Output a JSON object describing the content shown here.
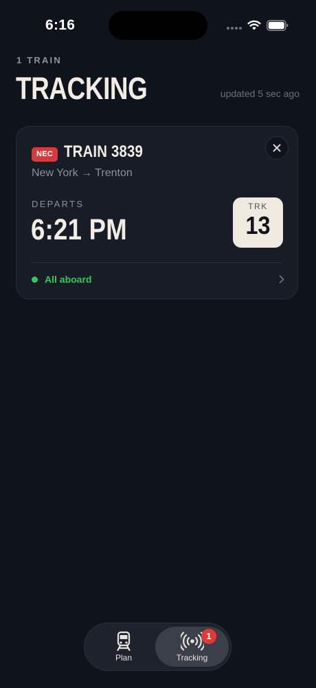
{
  "status_bar": {
    "time": "6:16",
    "icons": [
      "signal-icon",
      "wifi-icon",
      "battery-icon"
    ]
  },
  "header": {
    "count_label": "1 TRAIN",
    "title": "TRACKING",
    "updated": "updated 5 sec ago"
  },
  "train_card": {
    "line_badge": "NEC",
    "train_number": "TRAIN 3839",
    "route": "New York → Trenton",
    "departs_label": "DEPARTS",
    "depart_time": "6:21 PM",
    "track_label": "TRK",
    "track_number": "13",
    "status": "All aboard",
    "close_icon": "close-icon",
    "chevron_icon": "chevron-right-icon"
  },
  "tab_bar": {
    "tabs": [
      {
        "label": "Plan",
        "icon": "train-icon",
        "selected": false
      },
      {
        "label": "Tracking",
        "icon": "broadcast-icon",
        "selected": true,
        "badge": "1"
      }
    ]
  },
  "colors": {
    "background": "#0f131b",
    "card": "#171c27",
    "badge_red": "#d63a3f",
    "status_green": "#34c759",
    "track_box": "#efe9df",
    "notification_red": "#e53935"
  }
}
